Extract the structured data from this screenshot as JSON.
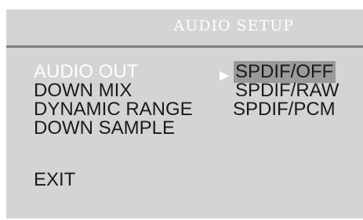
{
  "title": "AUDIO SETUP",
  "menu": {
    "items": [
      {
        "label": "AUDIO OUT",
        "active": true
      },
      {
        "label": "DOWN MIX",
        "active": false
      },
      {
        "label": "DYNAMIC RANGE",
        "active": false
      },
      {
        "label": "DOWN SAMPLE",
        "active": false
      },
      {
        "label": "EXIT",
        "active": false
      }
    ]
  },
  "submenu": {
    "arrow": "▶",
    "options": [
      {
        "label": "SPDIF/OFF",
        "selected": true
      },
      {
        "label": "SPDIF/RAW",
        "selected": false
      },
      {
        "label": "SPDIF/PCM",
        "selected": false
      }
    ]
  },
  "colors": {
    "panel_background": "#d4d4d4",
    "active_text": "#ffffff",
    "selection_highlight": "#9a9a9a",
    "divider": "#7d7d7d"
  }
}
